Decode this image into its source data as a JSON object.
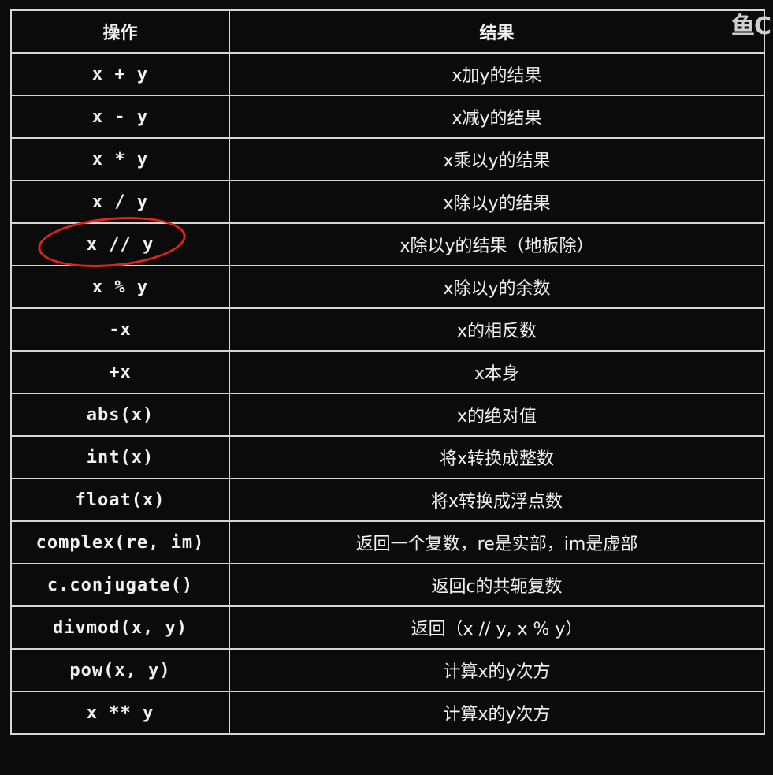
{
  "watermark": "鱼C",
  "table": {
    "headers": [
      "操作",
      "结果"
    ],
    "highlighted_row": 4,
    "rows": [
      {
        "op": "x + y",
        "result": "x加y的结果"
      },
      {
        "op": "x - y",
        "result": "x减y的结果"
      },
      {
        "op": "x * y",
        "result": "x乘以y的结果"
      },
      {
        "op": "x / y",
        "result": "x除以y的结果"
      },
      {
        "op": "x // y",
        "result": "x除以y的结果（地板除）"
      },
      {
        "op": "x % y",
        "result": "x除以y的余数"
      },
      {
        "op": "-x",
        "result": "x的相反数"
      },
      {
        "op": "+x",
        "result": "x本身"
      },
      {
        "op": "abs(x)",
        "result": "x的绝对值"
      },
      {
        "op": "int(x)",
        "result": "将x转换成整数"
      },
      {
        "op": "float(x)",
        "result": "将x转换成浮点数"
      },
      {
        "op": "complex(re, im)",
        "result": "返回一个复数，re是实部，im是虚部"
      },
      {
        "op": "c.conjugate()",
        "result": "返回c的共轭复数"
      },
      {
        "op": "divmod(x, y)",
        "result": "返回（x // y, x % y）"
      },
      {
        "op": "pow(x, y)",
        "result": "计算x的y次方"
      },
      {
        "op": "x ** y",
        "result": "计算x的y次方"
      }
    ]
  }
}
